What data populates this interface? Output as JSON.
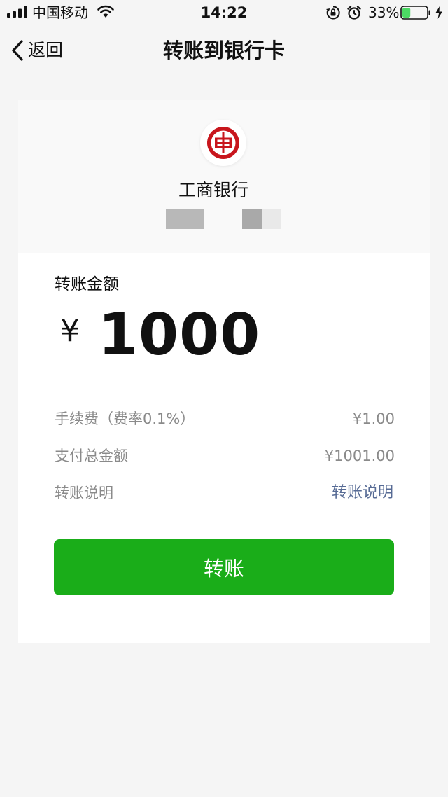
{
  "status_bar": {
    "carrier": "中国移动",
    "time": "14:22",
    "battery_percent": "33%",
    "battery_level": 0.33,
    "battery_color": "#4cd964",
    "icons": [
      "signal-icon",
      "wifi-icon",
      "rotation-lock-icon",
      "alarm-icon",
      "battery-icon",
      "charging-icon"
    ]
  },
  "nav": {
    "back_label": "返回",
    "title": "转账到银行卡"
  },
  "bank": {
    "name": "工商银行",
    "logo_icon": "icbc-logo-icon",
    "logo_color": "#c8161d"
  },
  "amount": {
    "label": "转账金额",
    "currency_symbol": "¥",
    "value": "1000"
  },
  "details": {
    "fee_label": "手续费（费率0.1%）",
    "fee_value": "¥1.00",
    "total_label": "支付总金额",
    "total_value": "¥1001.00",
    "desc_label": "转账说明",
    "desc_link": "转账说明",
    "link_color": "#576b95"
  },
  "action": {
    "button_label": "转账",
    "button_color": "#1aad19"
  }
}
